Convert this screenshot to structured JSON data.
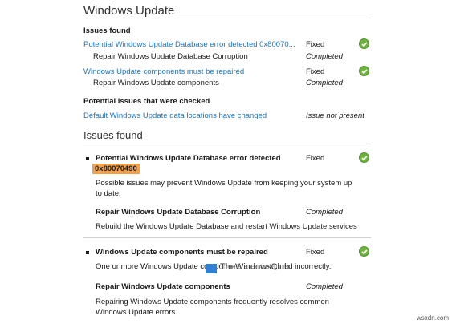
{
  "header": {
    "title": "Windows Update"
  },
  "summary": {
    "issues_heading": "Issues found",
    "issues": [
      {
        "label": "Potential Windows Update Database error detected 0x80070...",
        "status": "Fixed",
        "fix": "Repair Windows Update Database Corruption",
        "fix_status": "Completed"
      },
      {
        "label": "Windows Update components must be repaired",
        "status": "Fixed",
        "fix": "Repair Windows Update components",
        "fix_status": "Completed"
      }
    ],
    "checked_heading": "Potential issues that were checked",
    "checked": [
      {
        "label": "Default Windows Update data locations have changed",
        "status": "Issue not present"
      }
    ]
  },
  "details": {
    "heading": "Issues found",
    "issues": [
      {
        "title": "Potential Windows Update Database error detected",
        "code": "0x80070490",
        "status": "Fixed",
        "description": "Possible issues may prevent Windows Update from keeping your system up to date.",
        "fix_title": "Repair Windows Update Database Corruption",
        "fix_status": "Completed",
        "fix_description": "Rebuild the Windows Update Database and restart Windows Update services"
      },
      {
        "title": "Windows Update components must be repaired",
        "status": "Fixed",
        "description": "One or more Windows Update components are configured incorrectly.",
        "fix_title": "Repair Windows Update components",
        "fix_status": "Completed",
        "fix_description": "Repairing Windows Update components frequently resolves common Windows Update errors."
      }
    ]
  },
  "watermark": "TheWindowsClub",
  "footer": "wsxdn.com",
  "colors": {
    "link": "#1e73be",
    "check": "#6fb33f",
    "highlight": "#f0a04b"
  }
}
